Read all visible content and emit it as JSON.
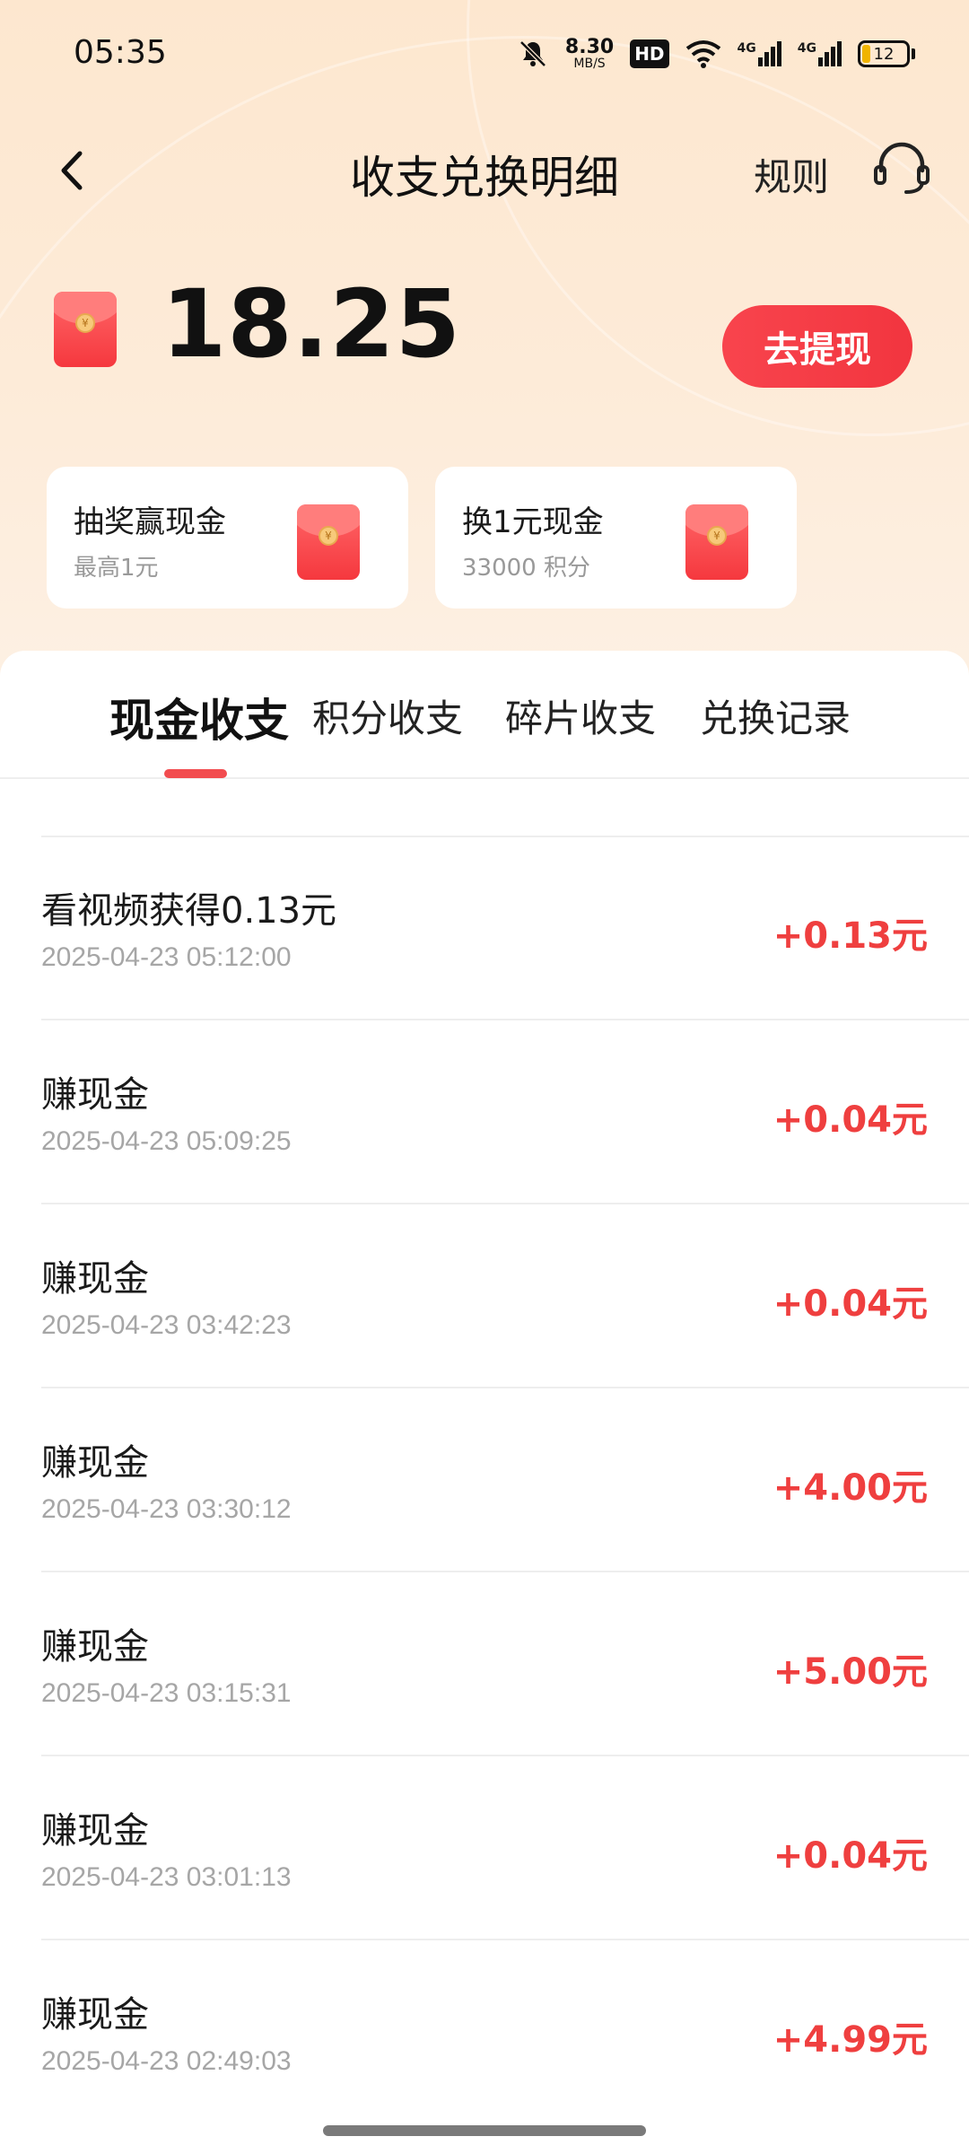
{
  "status_bar": {
    "time": "05:35",
    "net_speed_value": "8.30",
    "net_speed_unit": "MB/S",
    "hd_label": "HD",
    "signal_label_1": "4G",
    "signal_label_2": "4G",
    "battery_level": "12",
    "icons": [
      "mute-bell-icon",
      "wifi-icon",
      "signal-icon",
      "battery-icon"
    ]
  },
  "header": {
    "title": "收支兑换明细",
    "rules_label": "规则",
    "icons": [
      "back-arrow-icon",
      "headset-icon"
    ]
  },
  "balance": {
    "amount": "18.25",
    "withdraw_label": "去提现"
  },
  "promos": [
    {
      "title": "抽奖赢现金",
      "subtitle": "最高1元"
    },
    {
      "title": "换1元现金",
      "subtitle": "33000 积分"
    }
  ],
  "tabs": [
    {
      "label": "现金收支",
      "active": true
    },
    {
      "label": "积分收支",
      "active": false
    },
    {
      "label": "碎片收支",
      "active": false
    },
    {
      "label": "兑换记录",
      "active": false
    }
  ],
  "transactions": [
    {
      "title": "看视频获得0.13元",
      "time": "2025-04-23 05:12:00",
      "amount": "+0.13元"
    },
    {
      "title": "赚现金",
      "time": "2025-04-23 05:09:25",
      "amount": "+0.04元"
    },
    {
      "title": "赚现金",
      "time": "2025-04-23 03:42:23",
      "amount": "+0.04元"
    },
    {
      "title": "赚现金",
      "time": "2025-04-23 03:30:12",
      "amount": "+4.00元"
    },
    {
      "title": "赚现金",
      "time": "2025-04-23 03:15:31",
      "amount": "+5.00元"
    },
    {
      "title": "赚现金",
      "time": "2025-04-23 03:01:13",
      "amount": "+0.04元"
    },
    {
      "title": "赚现金",
      "time": "2025-04-23 02:49:03",
      "amount": "+4.99元"
    }
  ],
  "colors": {
    "accent_red": "#f2353f",
    "amount_red": "#ef3f3f",
    "header_bg": "#fde7cf"
  }
}
